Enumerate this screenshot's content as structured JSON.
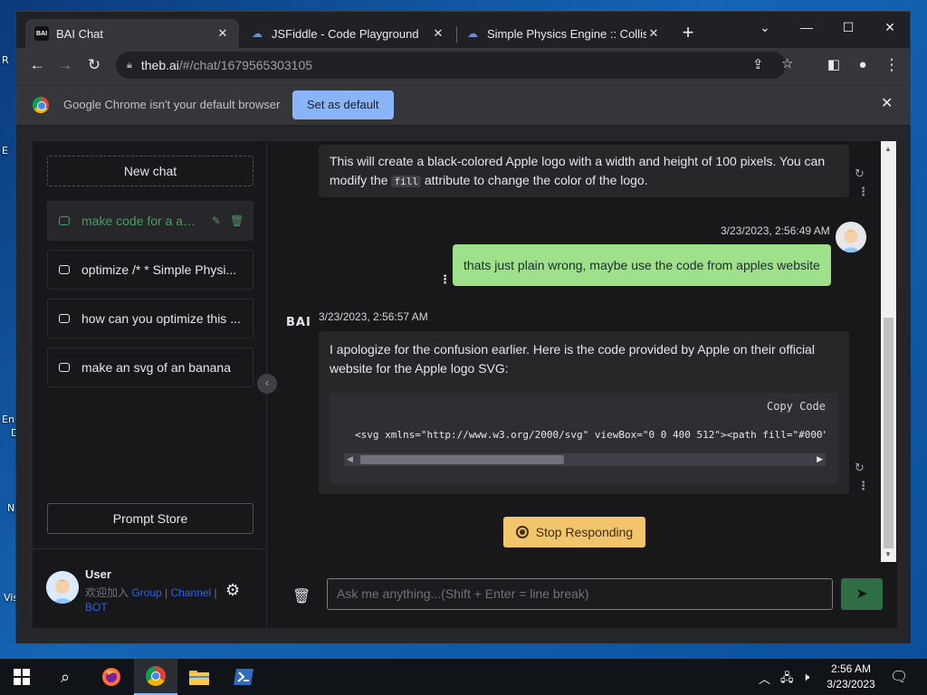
{
  "desktop": {
    "labels": [
      "R",
      "E",
      "En",
      "D",
      "N",
      "Vis"
    ]
  },
  "tabs": [
    {
      "title": "BAI Chat",
      "favicon": "BAI"
    },
    {
      "title": "JSFiddle - Code Playground"
    },
    {
      "title": "Simple Physics Engine :: Collision"
    }
  ],
  "address": {
    "host": "theb.ai",
    "path": "/#/chat/1679565303105"
  },
  "infobar": {
    "message": "Google Chrome isn't your default browser",
    "button": "Set as default"
  },
  "sidebar": {
    "new_chat": "New chat",
    "conversations": [
      {
        "title": "make code for a ap..."
      },
      {
        "title": "optimize /* * Simple Physi..."
      },
      {
        "title": "how can you optimize this ..."
      },
      {
        "title": "make an svg of an banana"
      }
    ],
    "prompt_store": "Prompt Store",
    "user": {
      "name": "User",
      "sub_prefix": "欢迎加入 ",
      "group": "Group",
      "sep1": " | ",
      "channel": "Channel",
      "sep2": " | ",
      "bot": "BOT"
    }
  },
  "messages": {
    "first": {
      "text_before": "This will create a black-colored Apple logo with a width and height of 100 pixels. You can modify the ",
      "code": "fill",
      "text_after": " attribute to change the color of the logo."
    },
    "user": {
      "timestamp": "3/23/2023, 2:56:49 AM",
      "text": "thats just plain wrong, maybe use the code from apples website"
    },
    "bot": {
      "logo": "BAI",
      "timestamp": "3/23/2023, 2:56:57 AM",
      "text": "I apologize for the confusion earlier. Here is the code provided by Apple on their official website for the Apple logo SVG:",
      "copy_label": "Copy Code",
      "code": "<svg xmlns=\"http://www.w3.org/2000/svg\" viewBox=\"0 0 400 512\"><path fill=\"#000\""
    }
  },
  "stop_button": "Stop Responding",
  "composer": {
    "placeholder": "Ask me anything...(Shift + Enter = line break)"
  },
  "taskbar": {
    "time": "2:56 AM",
    "date": "3/23/2023"
  },
  "colors": {
    "accent_green": "#4b9e5f",
    "user_bubble": "#9fe08a",
    "stop_button": "#f2c46b",
    "link_blue": "#2563eb"
  }
}
